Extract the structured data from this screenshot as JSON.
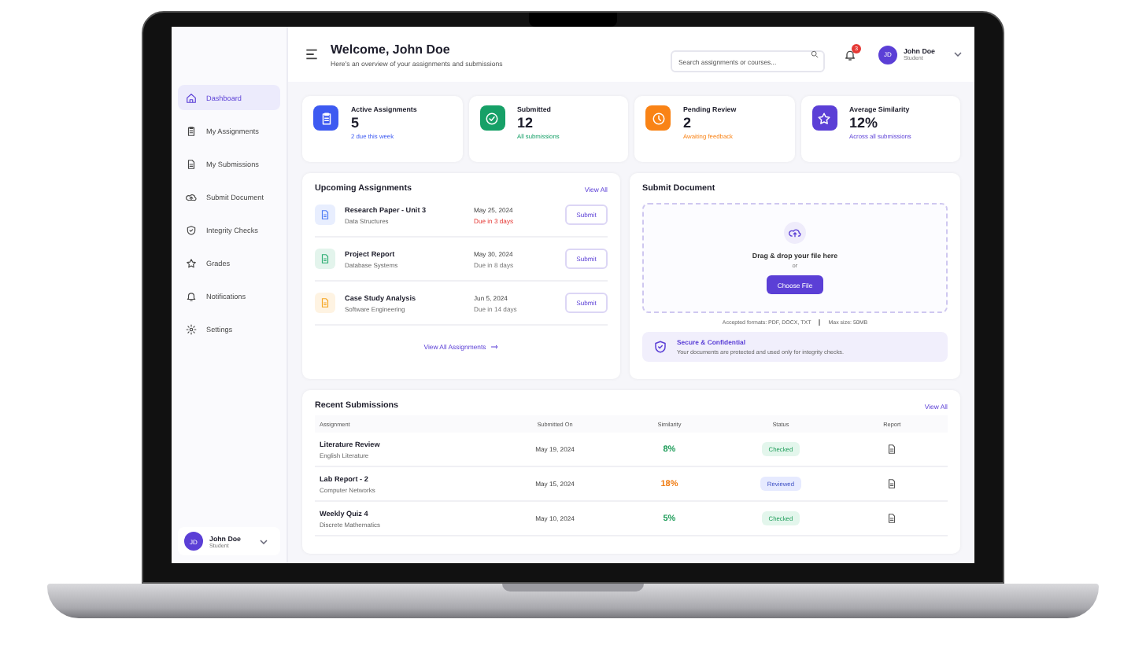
{
  "header": {
    "title": "Welcome, John Doe",
    "subtitle": "Here's an overview of your assignments and submissions",
    "search_placeholder": "Search assignments or courses...",
    "notification_count": "3",
    "user_name": "John Doe",
    "user_role": "Student",
    "avatar": "JD"
  },
  "sidebar": {
    "items": [
      {
        "label": "Dashboard",
        "selected": true
      },
      {
        "label": "My Assignments",
        "selected": false
      },
      {
        "label": "My Submissions",
        "selected": false
      },
      {
        "label": "Submit Document",
        "selected": false
      },
      {
        "label": "Integrity Checks",
        "selected": false
      },
      {
        "label": "Grades",
        "selected": false
      },
      {
        "label": "Notifications",
        "selected": false
      },
      {
        "label": "Settings",
        "selected": false
      }
    ],
    "user": {
      "avatar": "JD",
      "name": "John Doe",
      "role": "Student"
    }
  },
  "stats": [
    {
      "label": "Active Assignments",
      "value": "5",
      "note": "2 due this week",
      "color": "#3d5af1"
    },
    {
      "label": "Submitted",
      "value": "12",
      "note": "All submissions",
      "color": "#16a067"
    },
    {
      "label": "Pending Review",
      "value": "2",
      "note": "Awaiting feedback",
      "color": "#f98316"
    },
    {
      "label": "Average Similarity",
      "value": "12%",
      "note": "Across all submissions",
      "color": "#5b3fd6"
    }
  ],
  "upcoming": {
    "title": "Upcoming Assignments",
    "view_all": "View All",
    "items": [
      {
        "title": "Research Paper - Unit 3",
        "course": "Data Structures",
        "date": "May 25, 2024",
        "due": "Due in 3 days",
        "urgent": true,
        "color": "#4f7cf5",
        "button": "Submit"
      },
      {
        "title": "Project Report",
        "course": "Database Systems",
        "date": "May 30, 2024",
        "due": "Due in 8 days",
        "urgent": false,
        "color": "#2fae74",
        "button": "Submit"
      },
      {
        "title": "Case Study Analysis",
        "course": "Software Engineering",
        "date": "Jun 5, 2024",
        "due": "Due in 14 days",
        "urgent": false,
        "color": "#f5a623",
        "button": "Submit"
      }
    ],
    "footer_link": "View All Assignments"
  },
  "submit": {
    "title": "Submit Document",
    "drop_text": "Drag & drop your file here",
    "or": "or",
    "button": "Choose File",
    "formats": "Accepted formats: PDF, DOCX, TXT",
    "max_size": "Max size: 50MB",
    "secure_title": "Secure & Confidential",
    "secure_text": "Your documents are protected and used only for integrity checks."
  },
  "recent": {
    "title": "Recent Submissions",
    "view_all": "View All",
    "columns": [
      "Assignment",
      "Submitted On",
      "Similarity",
      "Status",
      "Report"
    ],
    "rows": [
      {
        "assignment": "Literature Review",
        "course": "English Literature",
        "date": "May 19, 2024",
        "similarity": "8%",
        "color": "#1f9d5a",
        "status": "Checked",
        "kind": "checked"
      },
      {
        "assignment": "Lab Report - 2",
        "course": "Computer Networks",
        "date": "May 15, 2024",
        "similarity": "18%",
        "color": "#f07c12",
        "status": "Reviewed",
        "kind": "reviewed"
      },
      {
        "assignment": "Weekly Quiz 4",
        "course": "Discrete Mathematics",
        "date": "May 10, 2024",
        "similarity": "5%",
        "color": "#1f9d5a",
        "status": "Checked",
        "kind": "checked"
      }
    ]
  }
}
